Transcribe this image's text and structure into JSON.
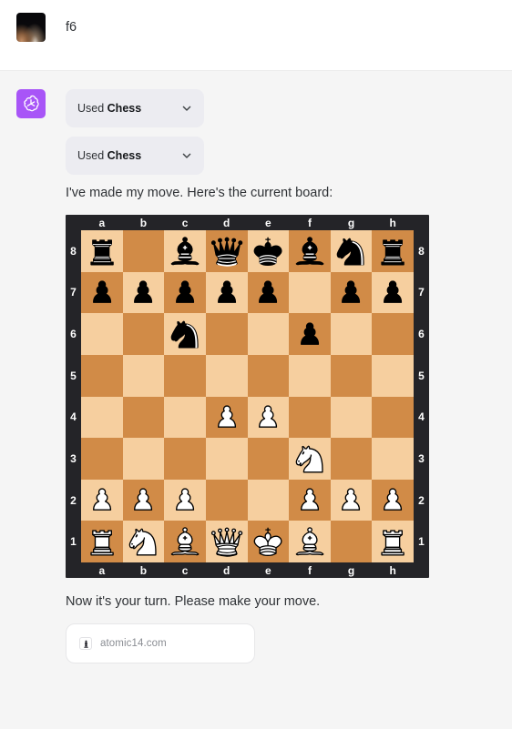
{
  "user": {
    "avatar_name": "user-photo-avatar",
    "message": "f6"
  },
  "assistant": {
    "avatar_name": "openai-logo-avatar",
    "avatar_bg": "#a855f7",
    "tool_calls": [
      {
        "prefix": "Used ",
        "name": "Chess",
        "chevron": "chevron-down-icon"
      },
      {
        "prefix": "Used ",
        "name": "Chess",
        "chevron": "chevron-down-icon"
      }
    ],
    "intro_text": "I've made my move. Here's the current board:",
    "outro_text": "Now it's your turn. Please make your move."
  },
  "source_card": {
    "favicon": "chess-pawn-icon",
    "label": "atomic14.com"
  },
  "board": {
    "files": [
      "a",
      "b",
      "c",
      "d",
      "e",
      "f",
      "g",
      "h"
    ],
    "ranks": [
      "8",
      "7",
      "6",
      "5",
      "4",
      "3",
      "2",
      "1"
    ],
    "light_square": "#f6cf9f",
    "dark_square": "#d18b47",
    "frame": "#242428",
    "label_color": "#fdfdfd",
    "rows": [
      [
        "br",
        "",
        "bb",
        "bq",
        "bk",
        "bb",
        "bn",
        "br"
      ],
      [
        "bp",
        "bp",
        "bp",
        "bp",
        "bp",
        "",
        "bp",
        "bp"
      ],
      [
        "",
        "",
        "bn",
        "",
        "",
        "bp",
        "",
        ""
      ],
      [
        "",
        "",
        "",
        "",
        "",
        "",
        "",
        ""
      ],
      [
        "",
        "",
        "",
        "wp",
        "wp",
        "",
        "",
        ""
      ],
      [
        "",
        "",
        "",
        "",
        "",
        "wn",
        "",
        ""
      ],
      [
        "wp",
        "wp",
        "wp",
        "",
        "",
        "wp",
        "wp",
        "wp"
      ],
      [
        "wr",
        "wn",
        "wb",
        "wq",
        "wk",
        "wb",
        "",
        "wr"
      ]
    ]
  }
}
